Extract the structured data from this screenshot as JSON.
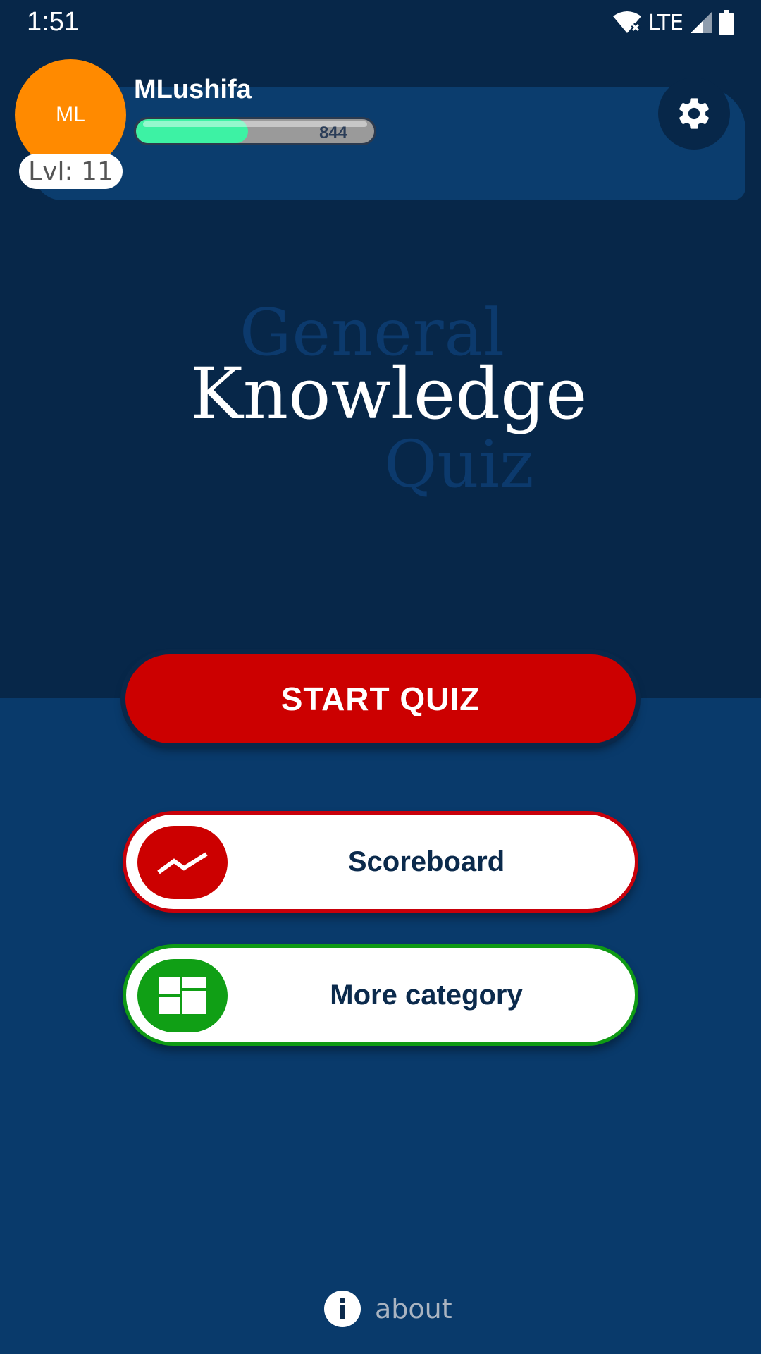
{
  "status_bar": {
    "time": "1:51",
    "network": "LTE",
    "icons": [
      "wifi-off-icon",
      "signal-icon",
      "battery-icon"
    ]
  },
  "profile": {
    "initials": "ML",
    "username": "MLushifa",
    "level_label": "Lvl: 11",
    "xp_value": "844",
    "xp_progress": 0.47,
    "avatar_color": "#ff8a00",
    "xp_color": "#3df2a4"
  },
  "header": {
    "settings_icon": "gear-icon"
  },
  "title": {
    "line1": "General",
    "line2": "Knowledge",
    "line3": "Quiz"
  },
  "actions": {
    "start_label": "START QUIZ",
    "scoreboard_label": "Scoreboard",
    "scoreboard_icon": "trending-up-icon",
    "more_category_label": "More category",
    "more_category_icon": "dashboard-icon"
  },
  "footer": {
    "about_label": "about",
    "about_icon": "info-icon"
  },
  "colors": {
    "background_top": "#072749",
    "background_bottom": "#093a6b",
    "accent_red": "#cc0000",
    "accent_green": "#109f15"
  }
}
